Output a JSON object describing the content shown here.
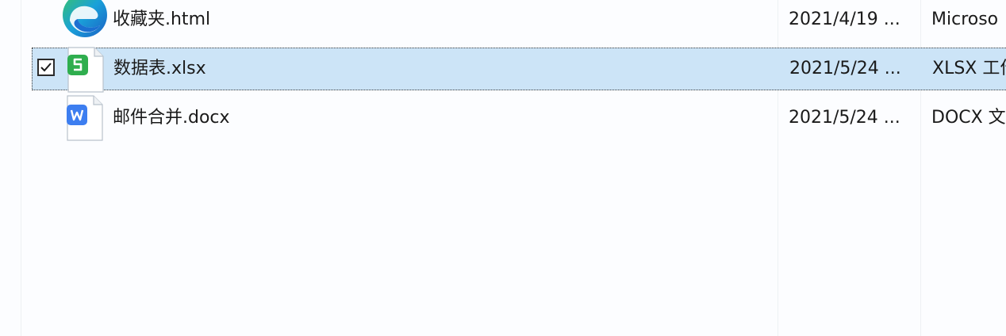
{
  "files": [
    {
      "name": "收藏夹.html",
      "date": "2021/4/19 ...",
      "type": "Microso",
      "icon": "edge-browser-icon",
      "selected": false,
      "checked": false
    },
    {
      "name": "数据表.xlsx",
      "date": "2021/5/24 ...",
      "type": "XLSX 工作",
      "icon": "wps-spreadsheet-icon",
      "selected": true,
      "checked": true
    },
    {
      "name": "邮件合并.docx",
      "date": "2021/5/24 ...",
      "type": "DOCX 文",
      "icon": "wps-writer-icon",
      "selected": false,
      "checked": false
    }
  ],
  "colors": {
    "selection_bg": "#cce4f7",
    "spreadsheet_green": "#2fae4e",
    "writer_blue": "#3d7ef0",
    "edge_blue": "#1b6fd1",
    "edge_green": "#38c36b"
  }
}
